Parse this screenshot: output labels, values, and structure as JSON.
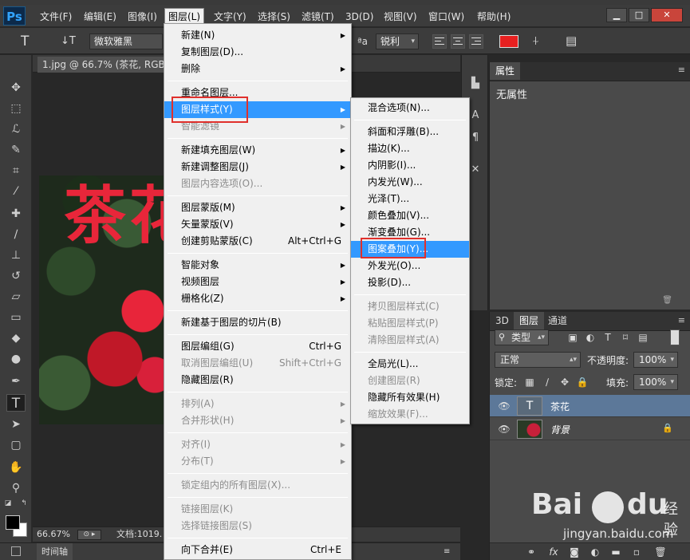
{
  "app": {
    "logo": "Ps",
    "menus": [
      "文件(F)",
      "编辑(E)",
      "图像(I)",
      "图层(L)",
      "文字(Y)",
      "选择(S)",
      "滤镜(T)",
      "3D(D)",
      "视图(V)",
      "窗口(W)",
      "帮助(H)"
    ],
    "active_menu": "图层(L)",
    "window_buttons": [
      "▁",
      "□",
      "✕"
    ]
  },
  "options_bar": {
    "tool_glyph": "T",
    "orient_glyph": "↓T",
    "font_family": "微软雅黑",
    "aa_symbol": "ªa",
    "anti_alias": "锐利",
    "text_color": "#e82020"
  },
  "document": {
    "tab_title": "1.jpg @ 66.7% (茶花, RGB/8",
    "text_layer_content": "茶花",
    "zoom": "66.67%",
    "doc_info": "文档:1019.",
    "timeline_label": "时间轴"
  },
  "properties_panel": {
    "tab": "属性",
    "empty_text": "无属性"
  },
  "layers_panel": {
    "tabs": [
      "3D",
      "图层",
      "通道"
    ],
    "filter_kind": "类型",
    "blend_mode": "正常",
    "opacity_label": "不透明度:",
    "opacity": "100%",
    "lock_label": "锁定:",
    "fill_label": "填充:",
    "fill": "100%",
    "layers": [
      {
        "name": "茶花",
        "type": "text",
        "selected": true
      },
      {
        "name": "背景",
        "type": "image",
        "selected": false,
        "locked": true
      }
    ],
    "footer_icons": [
      "link-icon",
      "fx-icon",
      "mask-icon",
      "adjustment-icon",
      "group-icon",
      "new-layer-icon",
      "trash-icon"
    ]
  },
  "layer_menu": {
    "items": [
      {
        "label": "新建(N)",
        "submenu": true
      },
      {
        "label": "复制图层(D)..."
      },
      {
        "label": "删除",
        "submenu": true
      },
      {
        "sep": true
      },
      {
        "label": "重命名图层..."
      },
      {
        "label": "图层样式(Y)",
        "submenu": true,
        "highlight": true
      },
      {
        "label": "智能滤镜",
        "submenu": true,
        "disabled": true
      },
      {
        "sep": true
      },
      {
        "label": "新建填充图层(W)",
        "submenu": true
      },
      {
        "label": "新建调整图层(J)",
        "submenu": true
      },
      {
        "label": "图层内容选项(O)...",
        "disabled": true
      },
      {
        "sep": true
      },
      {
        "label": "图层蒙版(M)",
        "submenu": true
      },
      {
        "label": "矢量蒙版(V)",
        "submenu": true
      },
      {
        "label": "创建剪贴蒙版(C)",
        "shortcut": "Alt+Ctrl+G"
      },
      {
        "sep": true
      },
      {
        "label": "智能对象",
        "submenu": true
      },
      {
        "label": "视频图层",
        "submenu": true
      },
      {
        "label": "栅格化(Z)",
        "submenu": true
      },
      {
        "sep": true
      },
      {
        "label": "新建基于图层的切片(B)"
      },
      {
        "sep": true
      },
      {
        "label": "图层编组(G)",
        "shortcut": "Ctrl+G"
      },
      {
        "label": "取消图层编组(U)",
        "shortcut": "Shift+Ctrl+G",
        "disabled": true
      },
      {
        "label": "隐藏图层(R)"
      },
      {
        "sep": true
      },
      {
        "label": "排列(A)",
        "submenu": true,
        "disabled": true
      },
      {
        "label": "合并形状(H)",
        "submenu": true,
        "disabled": true
      },
      {
        "sep": true
      },
      {
        "label": "对齐(I)",
        "submenu": true,
        "disabled": true
      },
      {
        "label": "分布(T)",
        "submenu": true,
        "disabled": true
      },
      {
        "sep": true
      },
      {
        "label": "锁定组内的所有图层(X)...",
        "disabled": true
      },
      {
        "sep": true
      },
      {
        "label": "链接图层(K)",
        "disabled": true
      },
      {
        "label": "选择链接图层(S)",
        "disabled": true
      },
      {
        "sep": true
      },
      {
        "label": "向下合并(E)",
        "shortcut": "Ctrl+E"
      }
    ]
  },
  "style_submenu": {
    "items": [
      {
        "label": "混合选项(N)..."
      },
      {
        "sep": true
      },
      {
        "label": "斜面和浮雕(B)..."
      },
      {
        "label": "描边(K)..."
      },
      {
        "label": "内阴影(I)..."
      },
      {
        "label": "内发光(W)..."
      },
      {
        "label": "光泽(T)..."
      },
      {
        "label": "颜色叠加(V)..."
      },
      {
        "label": "渐变叠加(G)..."
      },
      {
        "label": "图案叠加(Y)...",
        "highlight": true
      },
      {
        "label": "外发光(O)..."
      },
      {
        "label": "投影(D)..."
      },
      {
        "sep": true
      },
      {
        "label": "拷贝图层样式(C)",
        "disabled": true
      },
      {
        "label": "粘贴图层样式(P)",
        "disabled": true
      },
      {
        "label": "清除图层样式(A)",
        "disabled": true
      },
      {
        "sep": true
      },
      {
        "label": "全局光(L)..."
      },
      {
        "label": "创建图层(R)",
        "disabled": true
      },
      {
        "label": "隐藏所有效果(H)"
      },
      {
        "label": "缩放效果(F)...",
        "disabled": true
      }
    ]
  },
  "watermark": {
    "brand_a": "Bai",
    "brand_b": "du",
    "brand_c": "经验",
    "url": "jingyan.baidu.com"
  }
}
